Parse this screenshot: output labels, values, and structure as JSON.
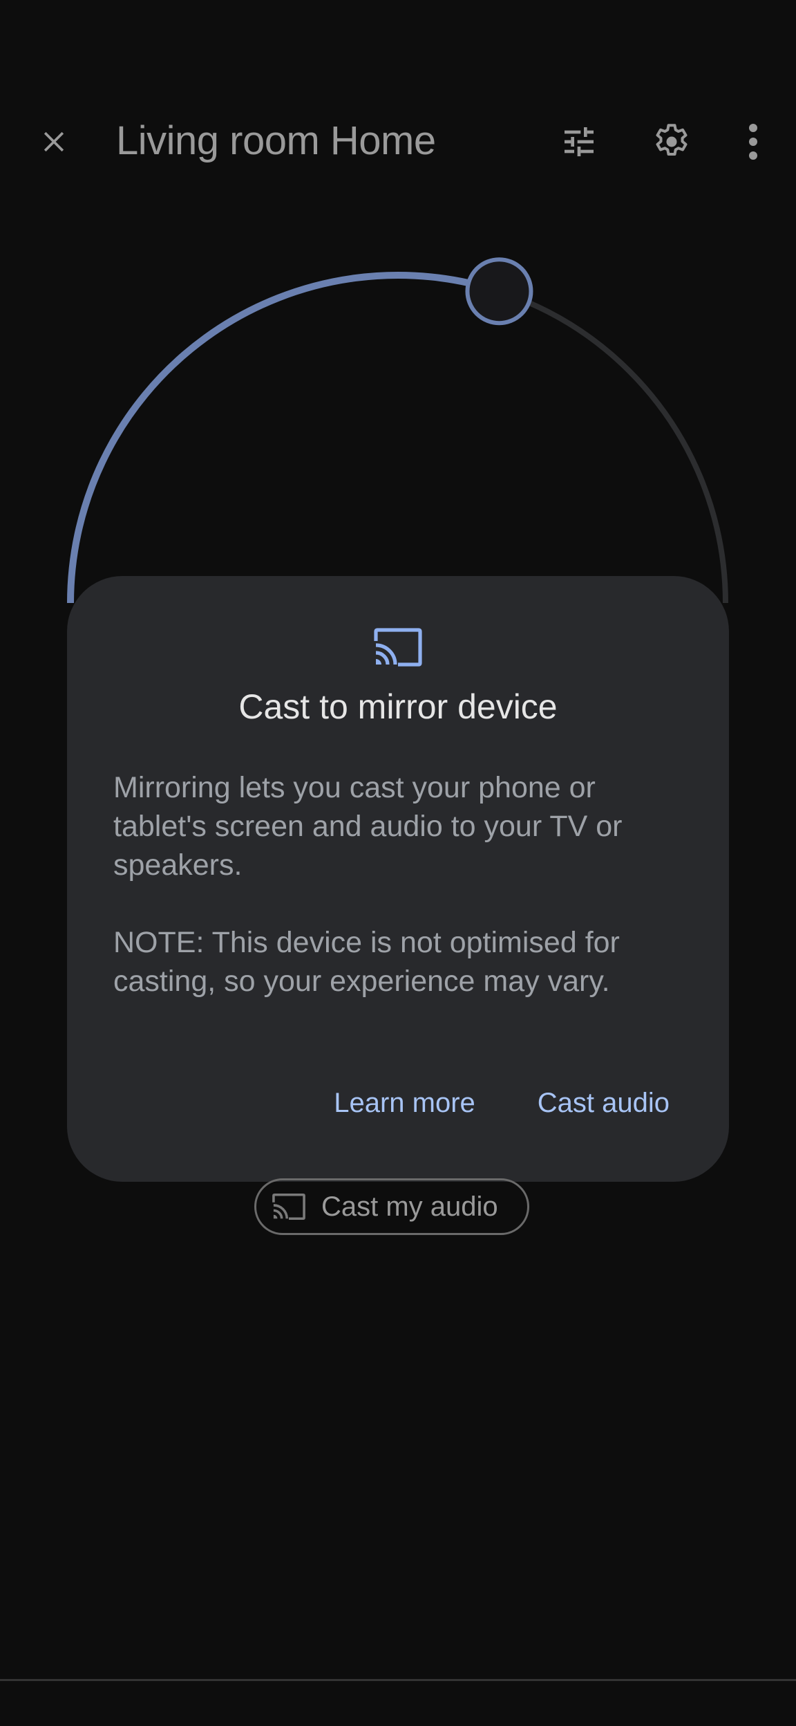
{
  "header": {
    "title": "Living room Home",
    "icons": [
      "close-icon",
      "equalizer-icon",
      "settings-gear-icon",
      "more-vert-icon"
    ]
  },
  "volume_dial": {
    "value_fraction": 0.6,
    "active_color": "#6a80b0",
    "track_color": "#2c2d2f"
  },
  "dialog": {
    "icon": "cast-icon",
    "title": "Cast to mirror device",
    "body_paragraph_1": "Mirroring lets you cast your phone or tablet's screen and audio to your TV or speakers.",
    "body_paragraph_2": "NOTE: This device is not optimised for casting, so your experience may vary.",
    "actions": {
      "learn_more": "Learn more",
      "cast_audio": "Cast audio"
    },
    "accent_color": "#a8c4f5"
  },
  "cast_chip": {
    "icon": "cast-icon",
    "label": "Cast my audio"
  }
}
